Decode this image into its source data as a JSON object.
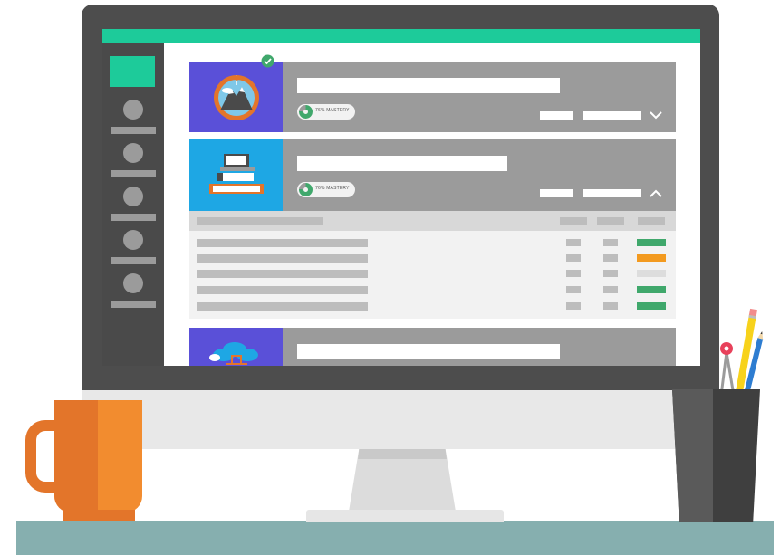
{
  "screen": {
    "cards": [
      {
        "mastery_label": "76% MASTERY",
        "mastery_fraction": 0.76,
        "state": "collapsed",
        "completed": true
      },
      {
        "mastery_label": "76% MASTERY",
        "mastery_fraction": 0.76,
        "state": "expanded",
        "completed": false
      },
      {
        "mastery_label": "",
        "state": "collapsed",
        "completed": false
      }
    ],
    "table": {
      "row_status_colors": [
        "#40A86C",
        "#F39A1F",
        "#DDDDDD",
        "#40A86C",
        "#40A86C"
      ]
    }
  },
  "colors": {
    "accent": "#1DCB9A",
    "card_gray": "#9B9B9B",
    "mastery_green": "#40A86C",
    "status_orange": "#F39A1F",
    "mug_orange": "#F28C2F",
    "desk": "#86AFAF"
  },
  "icons": {
    "card_1": "mountain-compass-icon",
    "card_2": "books-laptop-icon",
    "card_3": "cloud-network-icon",
    "completed": "check-circle-icon"
  }
}
